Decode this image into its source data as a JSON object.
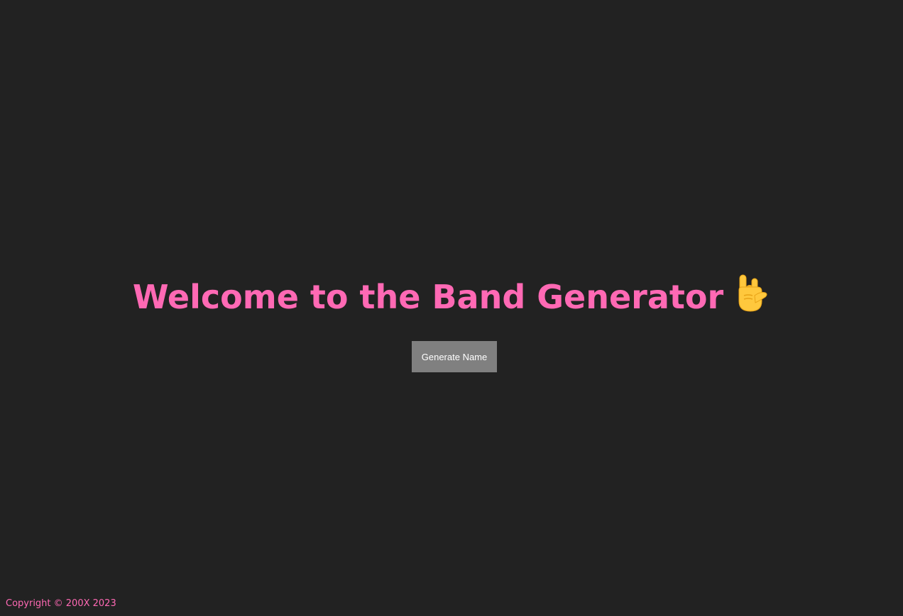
{
  "colors": {
    "background": "#222222",
    "accent": "#FF69B4",
    "button_background": "#808080",
    "button_text": "#FFFFFF"
  },
  "header": {
    "title": "Welcome to the Band Generator",
    "icon": "rock-on-hand-icon"
  },
  "actions": {
    "generate_label": "Generate Name"
  },
  "footer": {
    "copyright": "Copyright © 200X 2023"
  }
}
